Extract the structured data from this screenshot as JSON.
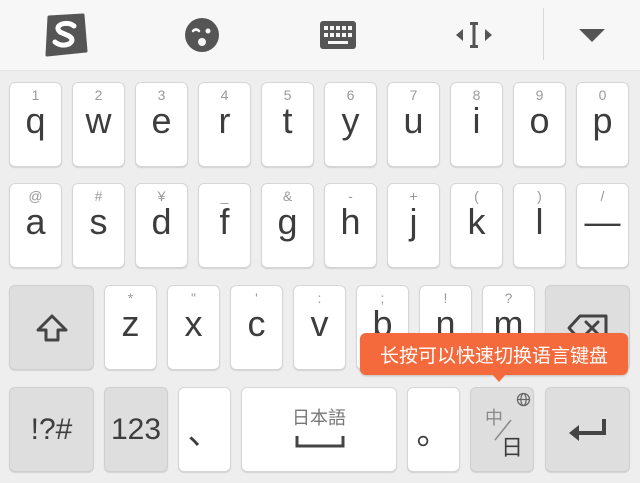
{
  "colors": {
    "accent": "#f46a3c",
    "keyBg": "#ffffff",
    "darkKeyBg": "#dedede",
    "icon": "#555555"
  },
  "toolbar": {
    "icons": [
      "sogou-logo-icon",
      "emoji-wink-icon",
      "keyboard-icon",
      "text-cursor-icon",
      "collapse-triangle-icon"
    ]
  },
  "rows": {
    "row1": [
      {
        "main": "q",
        "hint": "1"
      },
      {
        "main": "w",
        "hint": "2"
      },
      {
        "main": "e",
        "hint": "3"
      },
      {
        "main": "r",
        "hint": "4"
      },
      {
        "main": "t",
        "hint": "5"
      },
      {
        "main": "y",
        "hint": "6"
      },
      {
        "main": "u",
        "hint": "7"
      },
      {
        "main": "i",
        "hint": "8"
      },
      {
        "main": "o",
        "hint": "9"
      },
      {
        "main": "p",
        "hint": "0"
      }
    ],
    "row2": [
      {
        "main": "a",
        "hint": "@"
      },
      {
        "main": "s",
        "hint": "#"
      },
      {
        "main": "d",
        "hint": "¥"
      },
      {
        "main": "f",
        "hint": "_"
      },
      {
        "main": "g",
        "hint": "&"
      },
      {
        "main": "h",
        "hint": "-"
      },
      {
        "main": "j",
        "hint": "+"
      },
      {
        "main": "k",
        "hint": "("
      },
      {
        "main": "l",
        "hint": ")"
      },
      {
        "main": "—",
        "hint": "/"
      }
    ],
    "row3": [
      {
        "main": "z",
        "hint": "*"
      },
      {
        "main": "x",
        "hint": "\""
      },
      {
        "main": "c",
        "hint": "'"
      },
      {
        "main": "v",
        "hint": ":"
      },
      {
        "main": "b",
        "hint": ";"
      },
      {
        "main": "n",
        "hint": "!"
      },
      {
        "main": "m",
        "hint": "?"
      }
    ]
  },
  "bottom": {
    "symbols": "!?#",
    "numbers": "123",
    "comma": "、",
    "space_label": "日本語",
    "period": "。",
    "lang_top": "中",
    "lang_bottom": "日"
  },
  "tooltip": "长按可以快速切换语言键盘"
}
